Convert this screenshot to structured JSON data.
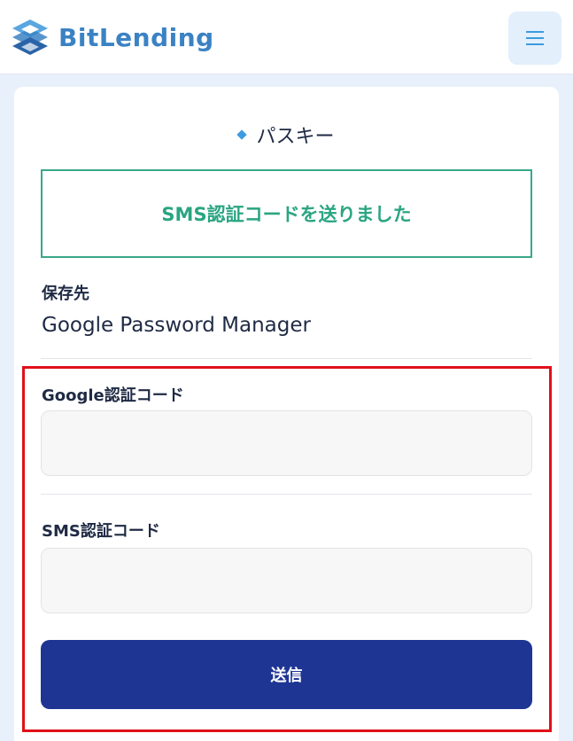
{
  "header": {
    "brand": "BitLending",
    "menu_icon": "hamburger-menu-icon"
  },
  "section": {
    "title": "パスキー"
  },
  "notice": {
    "text": "SMS認証コードを送りました"
  },
  "storage": {
    "label": "保存先",
    "value": "Google Password Manager"
  },
  "form": {
    "google_code_label": "Google認証コード",
    "google_code_value": "",
    "sms_code_label": "SMS認証コード",
    "sms_code_value": "",
    "submit_label": "送信"
  },
  "colors": {
    "brand": "#3b82c4",
    "notice": "#2aa581",
    "submit": "#1f3594",
    "highlight": "#e0101a"
  }
}
